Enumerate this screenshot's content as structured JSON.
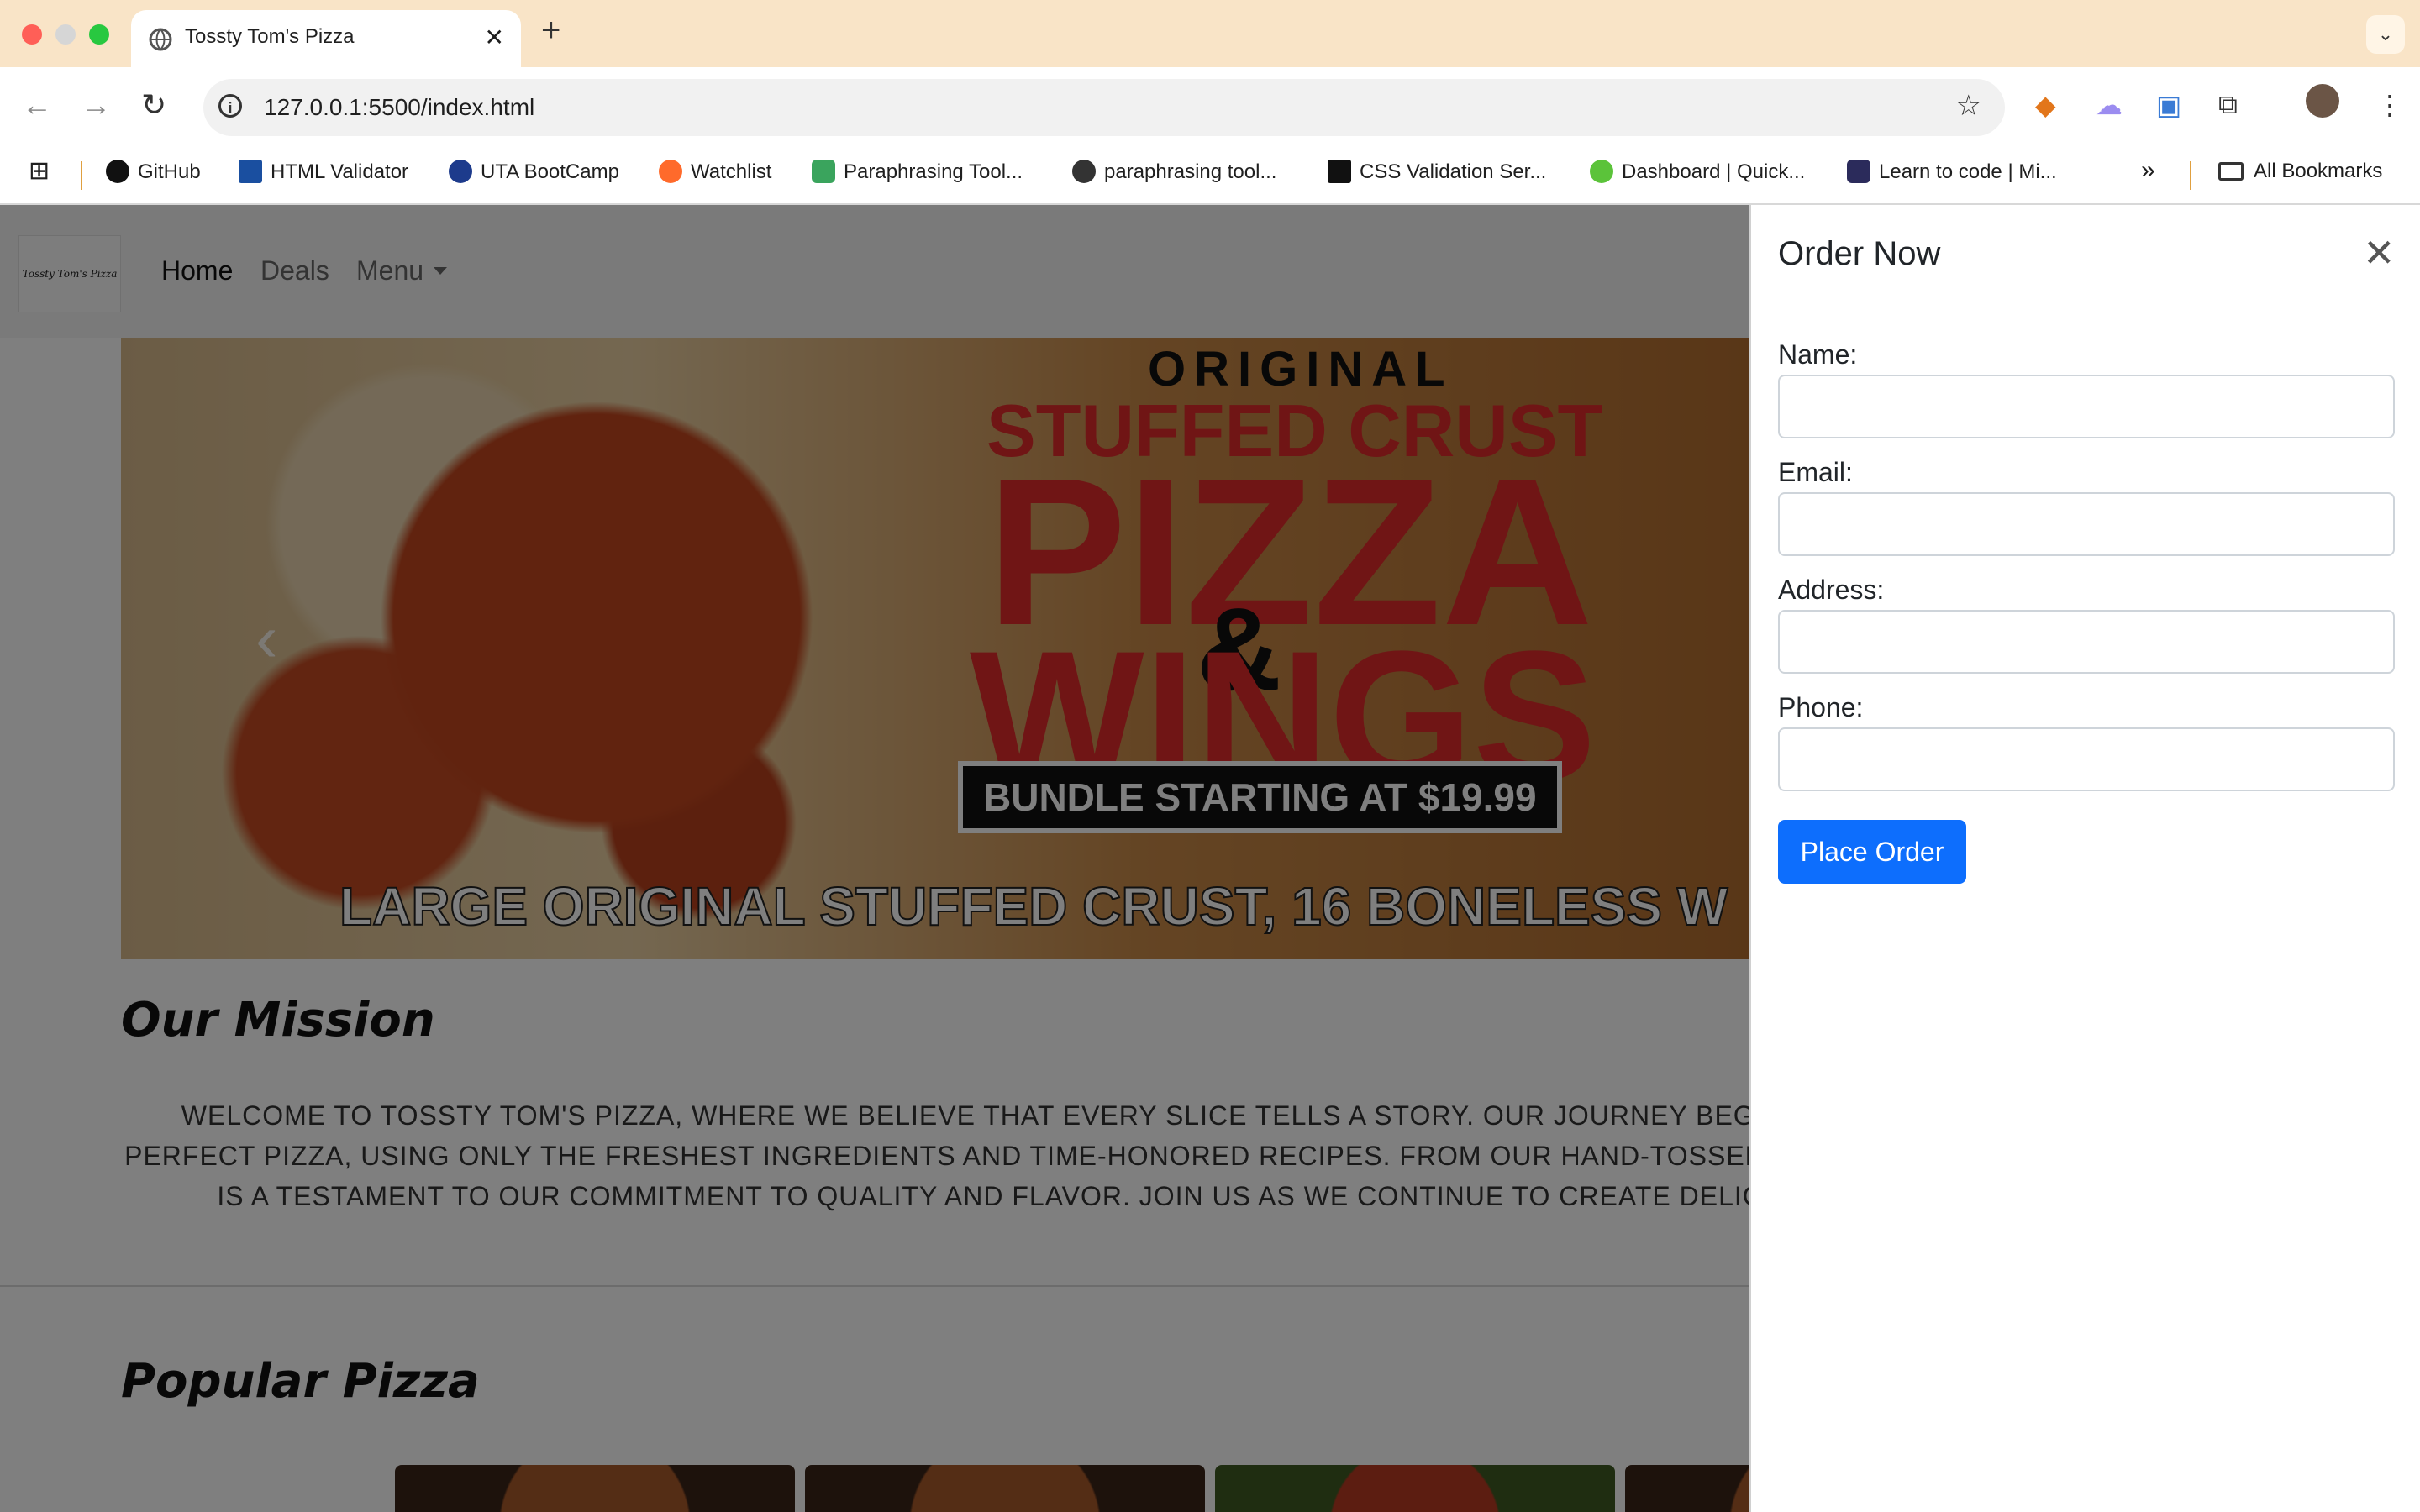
{
  "browser": {
    "tab_title": "Tossty Tom's Pizza",
    "tab_close": "✕",
    "new_tab": "+",
    "tab_menu": "⌄",
    "url": "127.0.0.1:5500/index.html",
    "back": "←",
    "forward": "→",
    "reload": "↻",
    "bookmark_star": "☆",
    "bookmarks": [
      {
        "label": "GitHub",
        "color": "#111111"
      },
      {
        "label": "HTML Validator",
        "color": "#1a4fa0"
      },
      {
        "label": "UTA BootCamp",
        "color": "#1d3b8c"
      },
      {
        "label": "Watchlist",
        "color": "#ff6a2b"
      },
      {
        "label": "Paraphrasing Tool...",
        "color": "#3aa45d"
      },
      {
        "label": "paraphrasing tool...",
        "color": "#333333"
      },
      {
        "label": "CSS Validation Ser...",
        "color": "#111111"
      },
      {
        "label": "Dashboard | Quick...",
        "color": "#5bc33a"
      },
      {
        "label": "Learn to code | Mi...",
        "color": "#2b2b5b"
      }
    ],
    "more_bookmarks": "»",
    "all_bookmarks": "All Bookmarks"
  },
  "site": {
    "logo_text": "Tossty Tom's Pizza",
    "nav": {
      "home": "Home",
      "deals": "Deals",
      "menu": "Menu"
    },
    "hero": {
      "line1": "ORIGINAL",
      "line2": "STUFFED CRUST",
      "line3": "PIZZA",
      "line4": "&",
      "line5": "WINGS",
      "line6": "BUNDLE STARTING AT $19.99",
      "line7": "LARGE ORIGINAL STUFFED CRUST, 16 BONELESS W",
      "prev": "‹"
    },
    "mission_title": "Our Mission",
    "mission_text": "WELCOME TO TOSSTY TOM'S PIZZA, WHERE WE BELIEVE THAT EVERY SLICE TELLS A STORY. OUR JOURNEY BEGAN W PERFECT PIZZA, USING ONLY THE FRESHEST INGREDIENTS AND TIME-HONORED RECIPES. FROM OUR HAND-TOSSED CR BITE IS A TESTAMENT TO OUR COMMITMENT TO QUALITY AND FLAVOR. JOIN US AS WE CONTINUE TO CREATE DELICIO",
    "popular_title": "Popular Pizza"
  },
  "order": {
    "title": "Order Now",
    "close": "✕",
    "name_label": "Name:",
    "email_label": "Email:",
    "address_label": "Address:",
    "phone_label": "Phone:",
    "submit": "Place Order"
  }
}
